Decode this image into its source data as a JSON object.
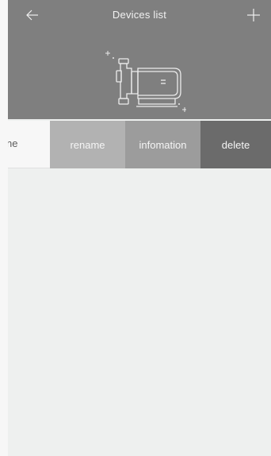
{
  "header": {
    "title": "Devices list",
    "back_icon": "arrow-left-icon",
    "add_icon": "plus-icon",
    "hero_icon": "pump-device-icon",
    "background": "#7f7f7f"
  },
  "device_row": {
    "partial_label": "ne",
    "actions": {
      "rename": "rename",
      "information": "infomation",
      "delete": "delete"
    },
    "colors": {
      "rename": "#b2b2b2",
      "information": "#9c9c9c",
      "delete": "#6b6b6b"
    }
  }
}
